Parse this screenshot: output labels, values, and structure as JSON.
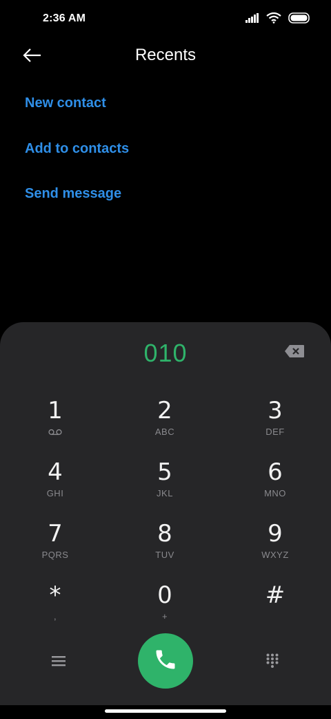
{
  "status_bar": {
    "time": "2:36 AM",
    "icons": [
      "signal-icon",
      "wifi-icon",
      "battery-icon"
    ]
  },
  "header": {
    "title": "Recents",
    "back_icon": "back-arrow-icon"
  },
  "actions": [
    {
      "label": "New contact"
    },
    {
      "label": "Add to contacts"
    },
    {
      "label": "Send message"
    }
  ],
  "dialer": {
    "number": "010",
    "backspace_icon": "backspace-icon",
    "keys": [
      {
        "digit": "1",
        "letters": "",
        "sub_icon": "voicemail-icon"
      },
      {
        "digit": "2",
        "letters": "ABC"
      },
      {
        "digit": "3",
        "letters": "DEF"
      },
      {
        "digit": "4",
        "letters": "GHI"
      },
      {
        "digit": "5",
        "letters": "JKL"
      },
      {
        "digit": "6",
        "letters": "MNO"
      },
      {
        "digit": "7",
        "letters": "PQRS"
      },
      {
        "digit": "8",
        "letters": "TUV"
      },
      {
        "digit": "9",
        "letters": "WXYZ"
      },
      {
        "digit": "*",
        "letters": ","
      },
      {
        "digit": "0",
        "letters": "+"
      },
      {
        "digit": "#",
        "letters": ""
      }
    ],
    "bottom": {
      "menu_icon": "menu-icon",
      "call_icon": "phone-icon",
      "dialpad_icon": "dialpad-icon"
    }
  },
  "colors": {
    "accent_blue": "#2f8fe8",
    "accent_green": "#2fb36a",
    "panel": "#262628",
    "background": "#000000"
  }
}
